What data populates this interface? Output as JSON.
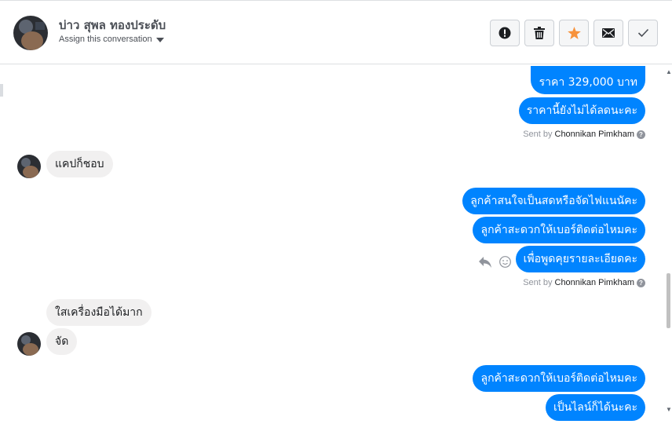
{
  "header": {
    "contact_name": "บ่าว สุพล ทองประดับ",
    "assign_label": "Assign this conversation",
    "actions": [
      {
        "name": "spam-button",
        "icon": "alert-icon"
      },
      {
        "name": "delete-button",
        "icon": "trash-icon"
      },
      {
        "name": "star-button",
        "icon": "star-icon"
      },
      {
        "name": "mark-unread-button",
        "icon": "envelope-icon"
      },
      {
        "name": "mark-done-button",
        "icon": "check-icon"
      }
    ]
  },
  "colors": {
    "outgoing": "#0084ff",
    "incoming": "#f1f0f0",
    "star": "#f7923b"
  },
  "messages": {
    "m1": "ราคา 329,000 บาท",
    "m2": "ราคานี้ยังไม่ได้ลดนะคะ",
    "m3": "แคปก็ชอบ",
    "m4": "ลูกค้าสนใจเป็นสดหรือจัดไฟแนนัคะ",
    "m5": "ลูกค้าสะดวกให้เบอร์ติดต่อไหมคะ",
    "m6": "เพื่อพูดคุยรายละเอียดคะ",
    "m7": "ใสเครื่องมือได้มาก",
    "m8": "จัด",
    "m9": "ลูกค้าสะดวกให้เบอร์ติดต่อไหมคะ",
    "m10": "เป็นไลน์ก็ได้นะคะ"
  },
  "sent_by": {
    "prefix": "Sent by",
    "agent": "Chonnikan Pimkham"
  }
}
